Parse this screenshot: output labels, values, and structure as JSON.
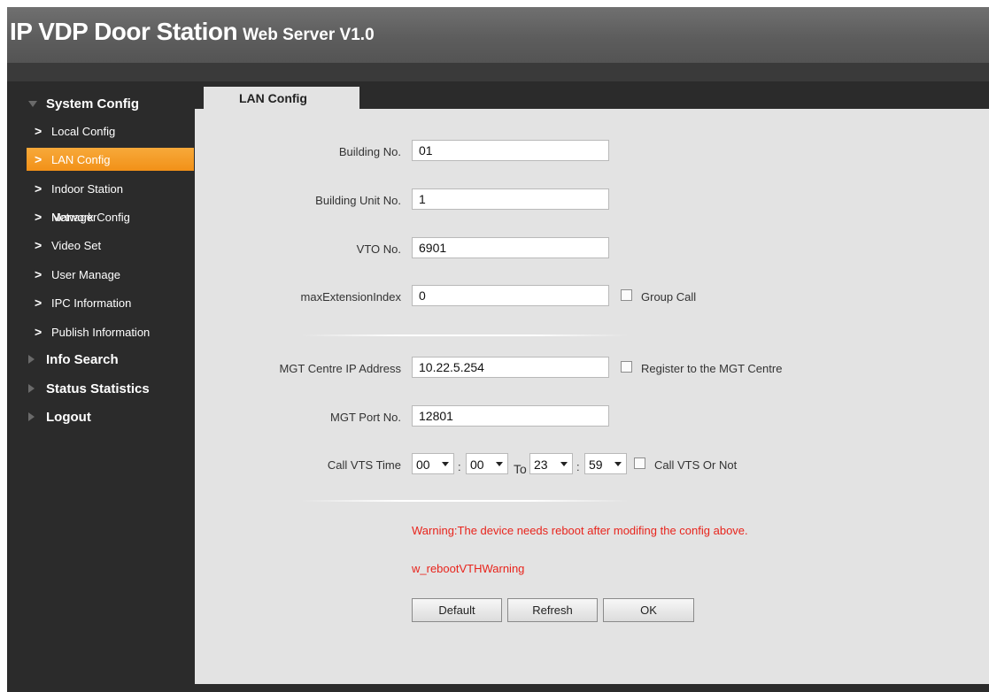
{
  "header": {
    "title": "IP VDP Door Station",
    "subtitle": "Web Server V1.0"
  },
  "sidebar": {
    "system_config": "System Config",
    "items": [
      {
        "label": "Local Config"
      },
      {
        "label": "LAN Config"
      },
      {
        "label": "Indoor Station"
      },
      {
        "label": "Network Config",
        "overlap_label": "Manager"
      },
      {
        "label": "Video Set"
      },
      {
        "label": "User Manage"
      },
      {
        "label": "IPC Information"
      },
      {
        "label": "Publish Information"
      }
    ],
    "info_search": "Info Search",
    "status_statistics": "Status Statistics",
    "logout": "Logout"
  },
  "tab": {
    "label": "LAN Config"
  },
  "form": {
    "building_no": {
      "label": "Building No.",
      "value": "01"
    },
    "building_unit_no": {
      "label": "Building Unit No.",
      "value": "1"
    },
    "vto_no": {
      "label": "VTO No.",
      "value": "6901"
    },
    "max_extension_index": {
      "label": "maxExtensionIndex",
      "value": "0"
    },
    "group_call": {
      "label": "Group Call",
      "checked": false
    },
    "mgt_ip": {
      "label": "MGT Centre IP Address",
      "value": "10.22.5.254"
    },
    "register_mgt": {
      "label": "Register to the MGT Centre",
      "checked": false
    },
    "mgt_port": {
      "label": "MGT Port No.",
      "value": "12801"
    },
    "call_vts_time": {
      "label": "Call VTS Time",
      "start_hour": "00",
      "start_min": "00",
      "to_label": "To",
      "end_hour": "23",
      "end_min": "59",
      "colon": ":"
    },
    "call_vts_or_not": {
      "label": "Call VTS Or Not",
      "checked": false
    }
  },
  "warnings": {
    "reboot": "Warning:The device needs reboot after modifing the config above.",
    "vth": "w_rebootVTHWarning"
  },
  "buttons": {
    "default": "Default",
    "refresh": "Refresh",
    "ok": "OK"
  },
  "colors": {
    "accent": "#f29118",
    "warning": "#e8241c",
    "sidebar_bg": "#2b2b2b",
    "content_bg": "#e3e3e3"
  }
}
